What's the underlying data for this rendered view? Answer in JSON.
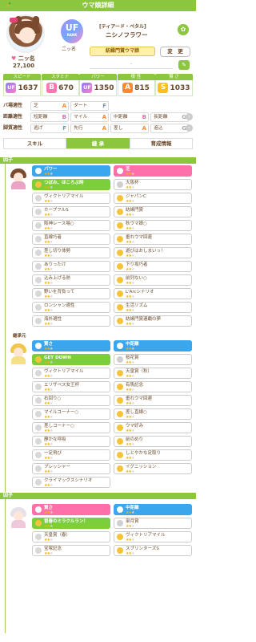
{
  "title": "ウマ娘詳細",
  "header": {
    "trainer_label": "二ッ名",
    "score": "27,100",
    "rank_badge": "UF",
    "rank_sub": "RANK",
    "epithet": "[ティアード・ペタル]",
    "name": "ニシノフラワー",
    "title_pill": "紡縁門賞ウマ娘",
    "change_button": "変　更",
    "dash": "-"
  },
  "stats": [
    {
      "label": "スピード",
      "grade": "UF",
      "value": "1637"
    },
    {
      "label": "スタミナ",
      "grade": "B",
      "value": "670"
    },
    {
      "label": "パワー",
      "grade": "UF",
      "value": "1350"
    },
    {
      "label": "根 性",
      "grade": "A",
      "value": "815"
    },
    {
      "label": "賢 さ",
      "grade": "S",
      "value": "1033"
    }
  ],
  "aptitudes": {
    "rows": [
      {
        "head": "バ場適性",
        "cells": [
          {
            "label": "芝",
            "grade": "A"
          },
          {
            "label": "ダート",
            "grade": "F"
          }
        ]
      },
      {
        "head": "距離適性",
        "cells": [
          {
            "label": "短距離",
            "grade": "B"
          },
          {
            "label": "マイル",
            "grade": "A"
          },
          {
            "label": "中距離",
            "grade": "B"
          },
          {
            "label": "長距離",
            "grade": "G"
          }
        ]
      },
      {
        "head": "脚質適性",
        "cells": [
          {
            "label": "逃げ",
            "grade": "F"
          },
          {
            "label": "先行",
            "grade": "A"
          },
          {
            "label": "差し",
            "grade": "A"
          },
          {
            "label": "追込",
            "grade": "G"
          }
        ]
      }
    ]
  },
  "tabs": [
    "スキル",
    "継 承",
    "育成情報"
  ],
  "inheritance": {
    "section1": "因子",
    "section2": "継承元",
    "section3": "因子",
    "group1": [
      [
        "パワー",
        "芝"
      ],
      [
        "つぼみ、ほころぶ時",
        "大阪杯"
      ],
      [
        "ヴィクトリアマイル",
        "ジャパンC"
      ],
      [
        "ホープフルS",
        "紡縁門賞"
      ],
      [
        "阪神レース場○",
        "秋ウマ娘○"
      ],
      [
        "直線巧者",
        "垂れウマ回避"
      ],
      [
        "差し切り体勢",
        "遊びはおしまいっ！"
      ],
      [
        "ありったけ",
        "下り坂巧者"
      ],
      [
        "込み上げる熱",
        "前列ない○"
      ],
      [
        "野いを背負って",
        "L'Arcシナリオ"
      ],
      [
        "ロンシャン適性",
        "生活リズム"
      ],
      [
        "海外適性",
        "紡縁門賞連覇の夢"
      ]
    ],
    "group2": [
      [
        "賢さ",
        "中距離"
      ],
      [
        "GET DOWN",
        "桜花賞"
      ],
      [
        "ヴィクトリアマイル",
        "天皇賞（秋）"
      ],
      [
        "エリザベス女王杯",
        "有馬記念"
      ],
      [
        "右回り○",
        "垂れウマ回避"
      ],
      [
        "マイルコーナー○",
        "差し直線○"
      ],
      [
        "差しコーナー○",
        "ウマ好み"
      ],
      [
        "静かな呼吸",
        "前のめり"
      ],
      [
        "一足飛び",
        "しとやかな足取り"
      ],
      [
        "プレッシャー",
        "イグニッション"
      ],
      [
        "クライマックスシナリオ",
        ""
      ]
    ],
    "group3": [
      [
        "賢さ",
        "中距離"
      ],
      [
        "冒春のミラクルラン！",
        "皐月賞"
      ],
      [
        "天皇賞（春）",
        "ヴィクトリアマイル"
      ],
      [
        "宝塚記念",
        "スプリンターズS"
      ]
    ]
  },
  "colors": {
    "accent": "#8cc63f",
    "blue": "#39a6ee",
    "pink": "#ff6fa8",
    "star": "#f0b400"
  }
}
